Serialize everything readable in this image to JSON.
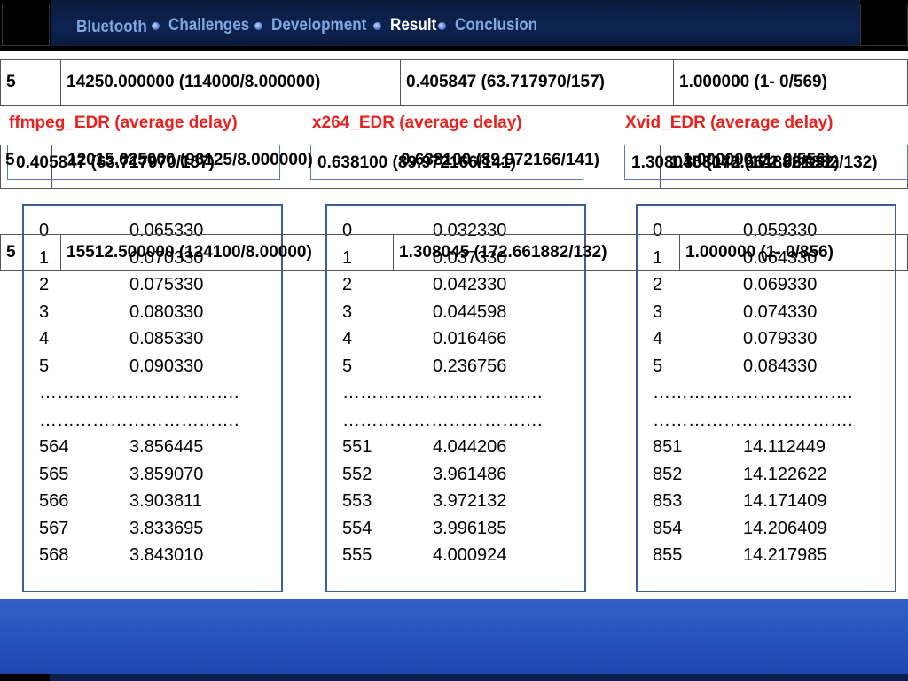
{
  "nav": {
    "items": [
      "Bluetooth",
      "Challenges",
      "Development",
      "Result",
      "Conclusion"
    ],
    "active": "Result"
  },
  "table_top": [
    "5",
    "14250.000000  (114000/8.000000)",
    "0.405847  (63.717970/157)",
    "1.000000  (1- 0/569)"
  ],
  "headings": [
    "ffmpeg_EDR (average delay)",
    "x264_EDR (average delay)",
    "Xvid_EDR (average delay)"
  ],
  "middle_overlap": {
    "a": "5",
    "b": "0.405847  (63.717970/157)",
    "c": "12015.625000  (96125/8.000000)",
    "d": "0.638100  (89.972166/141)",
    "e": "0.638100  (89.972166/141)",
    "f": "1.308045  (172.661882/132)",
    "g": "1.000000  (1- 0/556)",
    "h": "1.308045  (172.661882/132)"
  },
  "table_bottom": [
    "5",
    "15512.500000  (124100/8.00000)",
    "1.308045  (172.661882/132)",
    "1.000000 (1- 0/856)"
  ],
  "columns": [
    {
      "rows": [
        [
          "0",
          "0.065330"
        ],
        [
          "1",
          "0.070330"
        ],
        [
          "2",
          "0.075330"
        ],
        [
          "3",
          "0.080330"
        ],
        [
          "4",
          "0.085330"
        ],
        [
          "5",
          "0.090330"
        ]
      ],
      "ellipsis": [
        "…………………………….",
        "……………………………."
      ],
      "tail": [
        [
          "564",
          "3.856445"
        ],
        [
          "565",
          "3.859070"
        ],
        [
          "566",
          "3.903811"
        ],
        [
          "567",
          "3.833695"
        ],
        [
          "568",
          "3.843010"
        ]
      ]
    },
    {
      "rows": [
        [
          "0",
          "0.032330"
        ],
        [
          "1",
          "0.037330"
        ],
        [
          "2",
          "0.042330"
        ],
        [
          "3",
          "0.044598"
        ],
        [
          "4",
          "0.016466"
        ],
        [
          "5",
          "0.236756"
        ]
      ],
      "ellipsis": [
        "…………………………….",
        "……………………………."
      ],
      "tail": [
        [
          "551",
          "4.044206"
        ],
        [
          "552",
          "3.961486"
        ],
        [
          "553",
          "3.972132"
        ],
        [
          "554",
          "3.996185"
        ],
        [
          "555",
          "4.000924"
        ]
      ]
    },
    {
      "rows": [
        [
          "0",
          "0.059330"
        ],
        [
          "1",
          "0.064330"
        ],
        [
          "2",
          "0.069330"
        ],
        [
          "3",
          "0.074330"
        ],
        [
          "4",
          "0.079330"
        ],
        [
          "5",
          "0.084330"
        ]
      ],
      "ellipsis": [
        "…………………………….",
        "……………………………."
      ],
      "tail": [
        [
          "851",
          "14.112449"
        ],
        [
          "852",
          "14.122622"
        ],
        [
          "853",
          "14.171409"
        ],
        [
          "854",
          "14.206409"
        ],
        [
          "855",
          "14.217985"
        ]
      ]
    }
  ],
  "colors": {
    "nav_inactive": "#7fa7e0",
    "nav_active": "#ffffff",
    "heading_red": "#e8231f",
    "panel_border": "#3b5f93",
    "bottom_band": "#2a56bf"
  }
}
